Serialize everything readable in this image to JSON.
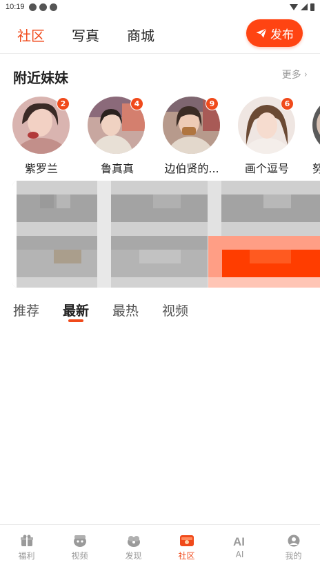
{
  "status_bar": {
    "time": "10:19"
  },
  "top_nav": {
    "tabs": [
      {
        "label": "社区",
        "active": true
      },
      {
        "label": "写真",
        "active": false
      },
      {
        "label": "商城",
        "active": false
      }
    ],
    "publish_label": "发布"
  },
  "nearby": {
    "title": "附近妹妹",
    "more_label": "更多",
    "people": [
      {
        "name": "紫罗兰",
        "badge": "2"
      },
      {
        "name": "鲁真真",
        "badge": "4"
      },
      {
        "name": "边伯贤的...",
        "badge": "9"
      },
      {
        "name": "画个逗号",
        "badge": "6"
      },
      {
        "name": "努",
        "badge": ""
      }
    ]
  },
  "feed_tabs": [
    {
      "label": "推荐",
      "active": false
    },
    {
      "label": "最新",
      "active": true
    },
    {
      "label": "最热",
      "active": false
    },
    {
      "label": "视频",
      "active": false
    }
  ],
  "bottom_nav": [
    {
      "label": "福利",
      "icon": "gift-icon",
      "active": false
    },
    {
      "label": "视频",
      "icon": "video-icon",
      "active": false
    },
    {
      "label": "发现",
      "icon": "discover-icon",
      "active": false
    },
    {
      "label": "社区",
      "icon": "community-icon",
      "active": true
    },
    {
      "label": "AI",
      "icon": "ai-icon",
      "active": false
    },
    {
      "label": "我的",
      "icon": "profile-icon",
      "active": false
    }
  ],
  "colors": {
    "accent": "#f04a1b",
    "publish_button": "#ff4412",
    "text": "#222222",
    "muted": "#999999"
  }
}
